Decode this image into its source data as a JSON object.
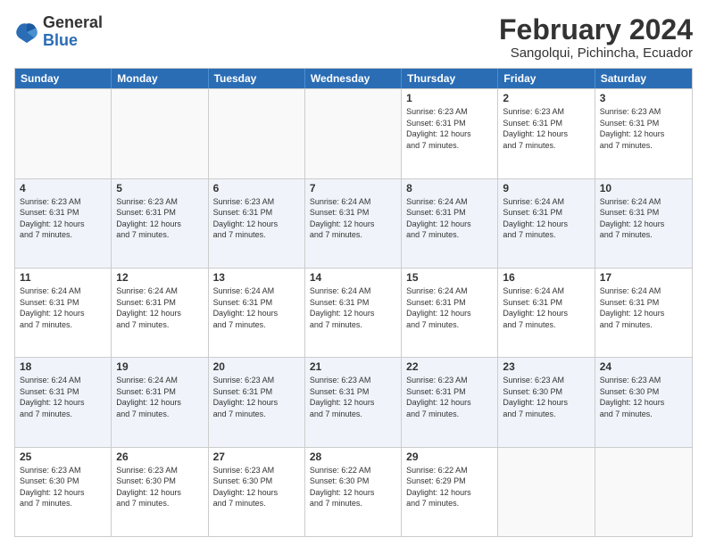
{
  "logo": {
    "general": "General",
    "blue": "Blue"
  },
  "title": {
    "month_year": "February 2024",
    "location": "Sangolqui, Pichincha, Ecuador"
  },
  "header": {
    "days": [
      "Sunday",
      "Monday",
      "Tuesday",
      "Wednesday",
      "Thursday",
      "Friday",
      "Saturday"
    ]
  },
  "rows": [
    {
      "cells": [
        {
          "empty": true
        },
        {
          "empty": true
        },
        {
          "empty": true
        },
        {
          "empty": true
        },
        {
          "num": "1",
          "info": "Sunrise: 6:23 AM\nSunset: 6:31 PM\nDaylight: 12 hours\nand 7 minutes."
        },
        {
          "num": "2",
          "info": "Sunrise: 6:23 AM\nSunset: 6:31 PM\nDaylight: 12 hours\nand 7 minutes."
        },
        {
          "num": "3",
          "info": "Sunrise: 6:23 AM\nSunset: 6:31 PM\nDaylight: 12 hours\nand 7 minutes."
        }
      ]
    },
    {
      "cells": [
        {
          "num": "4",
          "info": "Sunrise: 6:23 AM\nSunset: 6:31 PM\nDaylight: 12 hours\nand 7 minutes."
        },
        {
          "num": "5",
          "info": "Sunrise: 6:23 AM\nSunset: 6:31 PM\nDaylight: 12 hours\nand 7 minutes."
        },
        {
          "num": "6",
          "info": "Sunrise: 6:23 AM\nSunset: 6:31 PM\nDaylight: 12 hours\nand 7 minutes."
        },
        {
          "num": "7",
          "info": "Sunrise: 6:24 AM\nSunset: 6:31 PM\nDaylight: 12 hours\nand 7 minutes."
        },
        {
          "num": "8",
          "info": "Sunrise: 6:24 AM\nSunset: 6:31 PM\nDaylight: 12 hours\nand 7 minutes."
        },
        {
          "num": "9",
          "info": "Sunrise: 6:24 AM\nSunset: 6:31 PM\nDaylight: 12 hours\nand 7 minutes."
        },
        {
          "num": "10",
          "info": "Sunrise: 6:24 AM\nSunset: 6:31 PM\nDaylight: 12 hours\nand 7 minutes."
        }
      ]
    },
    {
      "cells": [
        {
          "num": "11",
          "info": "Sunrise: 6:24 AM\nSunset: 6:31 PM\nDaylight: 12 hours\nand 7 minutes."
        },
        {
          "num": "12",
          "info": "Sunrise: 6:24 AM\nSunset: 6:31 PM\nDaylight: 12 hours\nand 7 minutes."
        },
        {
          "num": "13",
          "info": "Sunrise: 6:24 AM\nSunset: 6:31 PM\nDaylight: 12 hours\nand 7 minutes."
        },
        {
          "num": "14",
          "info": "Sunrise: 6:24 AM\nSunset: 6:31 PM\nDaylight: 12 hours\nand 7 minutes."
        },
        {
          "num": "15",
          "info": "Sunrise: 6:24 AM\nSunset: 6:31 PM\nDaylight: 12 hours\nand 7 minutes."
        },
        {
          "num": "16",
          "info": "Sunrise: 6:24 AM\nSunset: 6:31 PM\nDaylight: 12 hours\nand 7 minutes."
        },
        {
          "num": "17",
          "info": "Sunrise: 6:24 AM\nSunset: 6:31 PM\nDaylight: 12 hours\nand 7 minutes."
        }
      ]
    },
    {
      "cells": [
        {
          "num": "18",
          "info": "Sunrise: 6:24 AM\nSunset: 6:31 PM\nDaylight: 12 hours\nand 7 minutes."
        },
        {
          "num": "19",
          "info": "Sunrise: 6:24 AM\nSunset: 6:31 PM\nDaylight: 12 hours\nand 7 minutes."
        },
        {
          "num": "20",
          "info": "Sunrise: 6:23 AM\nSunset: 6:31 PM\nDaylight: 12 hours\nand 7 minutes."
        },
        {
          "num": "21",
          "info": "Sunrise: 6:23 AM\nSunset: 6:31 PM\nDaylight: 12 hours\nand 7 minutes."
        },
        {
          "num": "22",
          "info": "Sunrise: 6:23 AM\nSunset: 6:31 PM\nDaylight: 12 hours\nand 7 minutes."
        },
        {
          "num": "23",
          "info": "Sunrise: 6:23 AM\nSunset: 6:30 PM\nDaylight: 12 hours\nand 7 minutes."
        },
        {
          "num": "24",
          "info": "Sunrise: 6:23 AM\nSunset: 6:30 PM\nDaylight: 12 hours\nand 7 minutes."
        }
      ]
    },
    {
      "cells": [
        {
          "num": "25",
          "info": "Sunrise: 6:23 AM\nSunset: 6:30 PM\nDaylight: 12 hours\nand 7 minutes."
        },
        {
          "num": "26",
          "info": "Sunrise: 6:23 AM\nSunset: 6:30 PM\nDaylight: 12 hours\nand 7 minutes."
        },
        {
          "num": "27",
          "info": "Sunrise: 6:23 AM\nSunset: 6:30 PM\nDaylight: 12 hours\nand 7 minutes."
        },
        {
          "num": "28",
          "info": "Sunrise: 6:22 AM\nSunset: 6:30 PM\nDaylight: 12 hours\nand 7 minutes."
        },
        {
          "num": "29",
          "info": "Sunrise: 6:22 AM\nSunset: 6:29 PM\nDaylight: 12 hours\nand 7 minutes."
        },
        {
          "empty": true
        },
        {
          "empty": true
        }
      ]
    }
  ]
}
